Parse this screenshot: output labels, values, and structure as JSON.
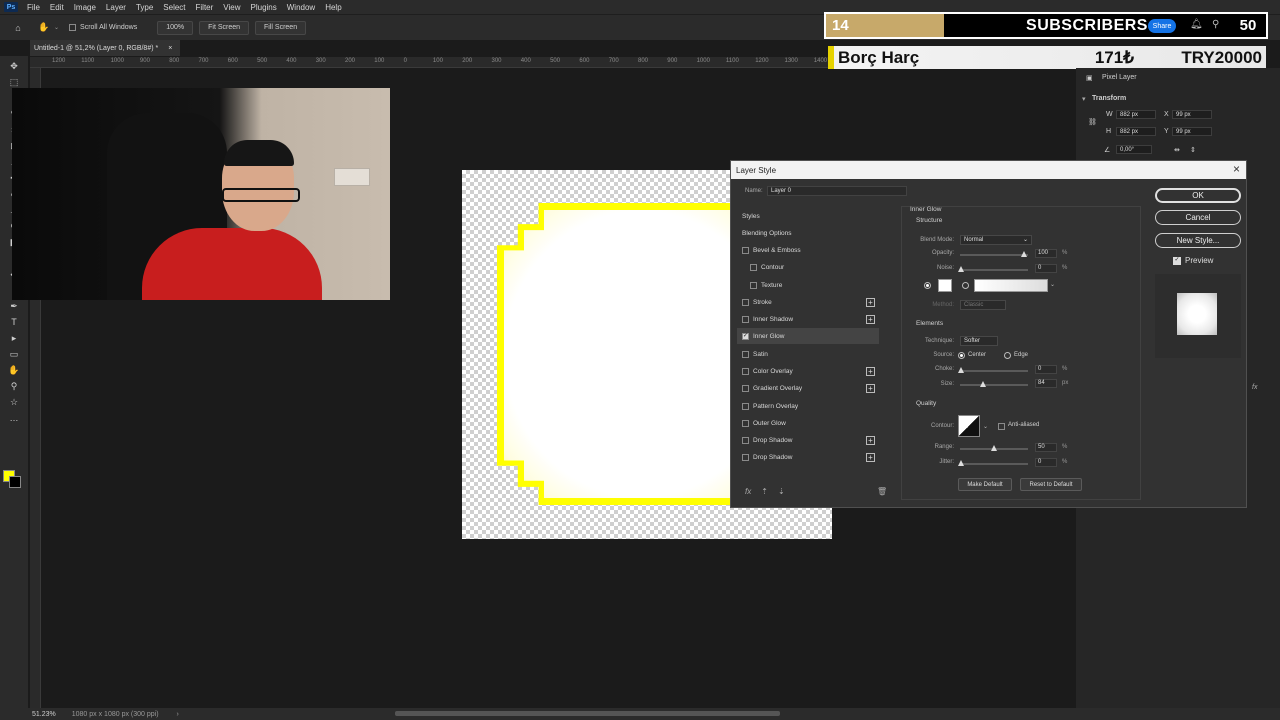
{
  "menubar": {
    "logo": "Ps",
    "items": [
      "File",
      "Edit",
      "Image",
      "Layer",
      "Type",
      "Select",
      "Filter",
      "View",
      "Plugins",
      "Window",
      "Help"
    ]
  },
  "options_bar": {
    "scroll_all_windows": "Scroll All Windows",
    "zoom_100": "100%",
    "fit_screen": "Fit Screen",
    "fill_screen": "Fill Screen"
  },
  "document_tab": {
    "title": "Untitled-1 @ 51,2% (Layer 0, RGB/8#) *",
    "close": "×"
  },
  "ruler_ticks": [
    "1200",
    "1100",
    "1000",
    "900",
    "800",
    "700",
    "600",
    "500",
    "400",
    "300",
    "200",
    "100",
    "0",
    "100",
    "200",
    "300",
    "400",
    "500",
    "600",
    "700",
    "800",
    "900",
    "1000",
    "1100",
    "1200",
    "1300",
    "1400",
    "1500",
    "1600",
    "1700",
    "1800",
    "1900",
    "2000",
    "2100",
    "2200"
  ],
  "overlay": {
    "subscriber_count": "14",
    "subscriber_label": "SUBSCRIBERS",
    "subscriber_goal": "50",
    "share_label": "Share",
    "donation_name": "Borç Harç",
    "donation_amount": "171₺",
    "donation_goal": "TRY20000"
  },
  "properties_panel": {
    "pixel_layer": "Pixel Layer",
    "transform": "Transform",
    "w_label": "W",
    "w_value": "882 px",
    "h_label": "H",
    "h_value": "882 px",
    "x_label": "X",
    "x_value": "99 px",
    "y_label": "Y",
    "y_value": "99 px",
    "angle_value": "0,00°"
  },
  "layer_style": {
    "title": "Layer Style",
    "name_label": "Name:",
    "name_value": "Layer 0",
    "styles_header": "Styles",
    "blending_options": "Blending Options",
    "items": [
      {
        "label": "Bevel & Emboss",
        "checked": false,
        "plus": false,
        "indent": false
      },
      {
        "label": "Contour",
        "checked": false,
        "plus": false,
        "indent": true
      },
      {
        "label": "Texture",
        "checked": false,
        "plus": false,
        "indent": true
      },
      {
        "label": "Stroke",
        "checked": false,
        "plus": true,
        "indent": false
      },
      {
        "label": "Inner Shadow",
        "checked": false,
        "plus": true,
        "indent": false
      },
      {
        "label": "Inner Glow",
        "checked": true,
        "plus": false,
        "indent": false
      },
      {
        "label": "Satin",
        "checked": false,
        "plus": false,
        "indent": false
      },
      {
        "label": "Color Overlay",
        "checked": false,
        "plus": true,
        "indent": false
      },
      {
        "label": "Gradient Overlay",
        "checked": false,
        "plus": true,
        "indent": false
      },
      {
        "label": "Pattern Overlay",
        "checked": false,
        "plus": false,
        "indent": false
      },
      {
        "label": "Outer Glow",
        "checked": false,
        "plus": false,
        "indent": false
      },
      {
        "label": "Drop Shadow",
        "checked": false,
        "plus": true,
        "indent": false
      },
      {
        "label": "Drop Shadow",
        "checked": false,
        "plus": true,
        "indent": false
      }
    ],
    "fx_label": "fx",
    "inner_glow": {
      "section": "Inner Glow",
      "structure": "Structure",
      "blend_mode_label": "Blend Mode:",
      "blend_mode": "Normal",
      "opacity_label": "Opacity:",
      "opacity": "100",
      "noise_label": "Noise:",
      "noise": "0",
      "glow_color": "#ffffff",
      "method_label": "Method:",
      "method": "Classic",
      "elements": "Elements",
      "technique_label": "Technique:",
      "technique": "Softer",
      "source_label": "Source:",
      "source_center": "Center",
      "source_edge": "Edge",
      "choke_label": "Choke:",
      "choke": "0",
      "size_label": "Size:",
      "size": "84",
      "quality": "Quality",
      "contour_label": "Contour:",
      "anti_aliased": "Anti-aliased",
      "range_label": "Range:",
      "range": "50",
      "jitter_label": "Jitter:",
      "jitter": "0",
      "pct": "%",
      "px": "px",
      "make_default": "Make Default",
      "reset_default": "Reset to Default"
    },
    "ok": "OK",
    "cancel": "Cancel",
    "new_style": "New Style...",
    "preview": "Preview"
  },
  "status_bar": {
    "zoom": "51.23%",
    "doc_info": "1080 px x 1080 px (300 ppi)"
  },
  "colors": {
    "foreground": "#ffff00",
    "background": "#000000",
    "accent": "#1473e6"
  }
}
